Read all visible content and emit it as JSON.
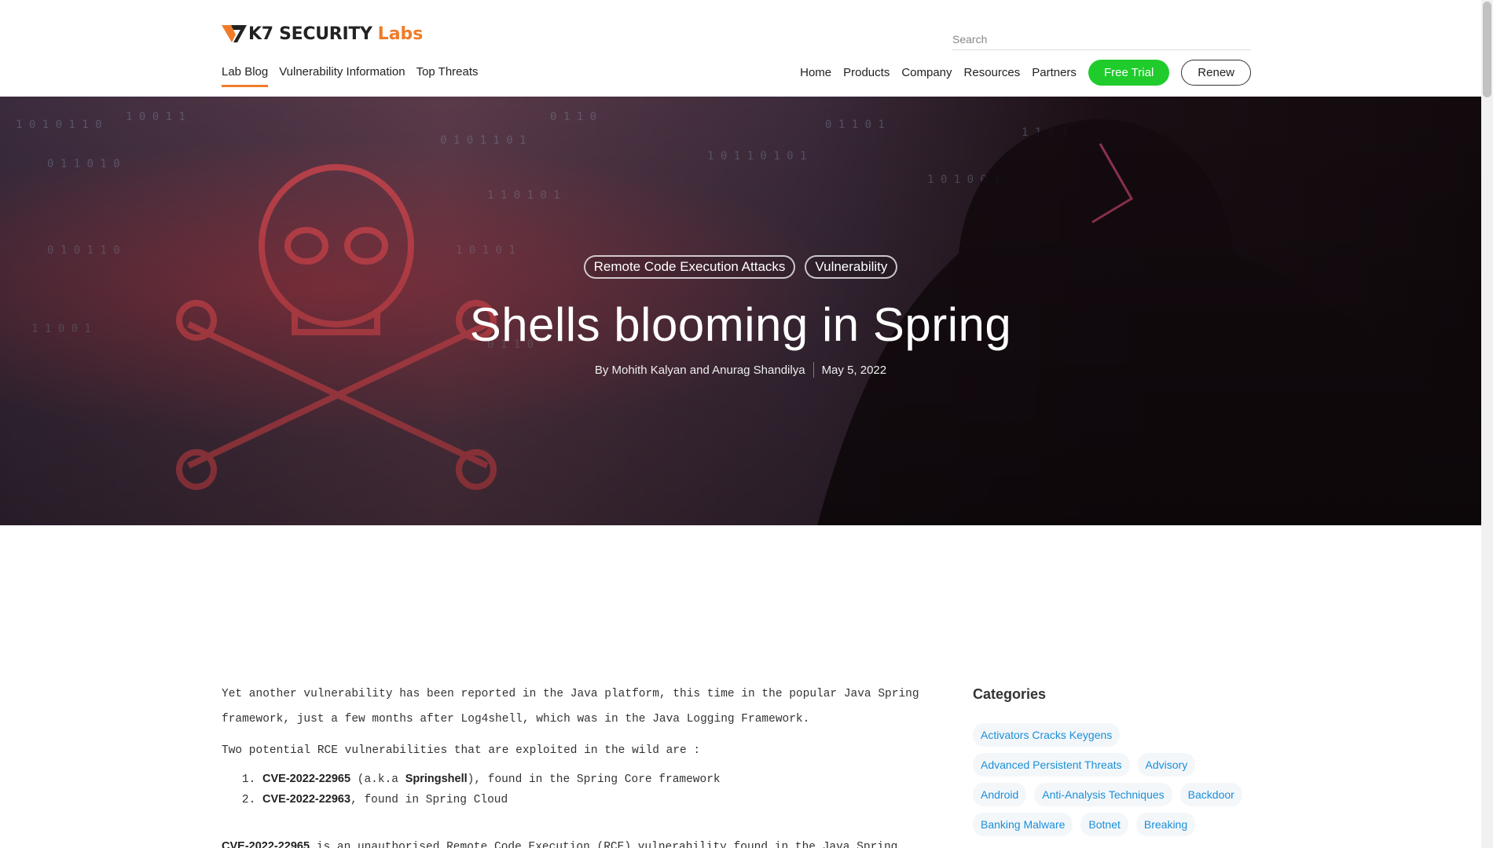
{
  "header": {
    "logo_brand": "K7 SECURITY",
    "logo_labs": "Labs",
    "search_placeholder": "Search",
    "left_nav": [
      "Lab Blog",
      "Vulnerability Information",
      "Top Threats"
    ],
    "right_nav": [
      "Home",
      "Products",
      "Company",
      "Resources",
      "Partners"
    ],
    "free_trial_label": "Free Trial",
    "renew_label": "Renew"
  },
  "hero": {
    "tags": [
      "Remote Code Execution Attacks",
      "Vulnerability"
    ],
    "title": "Shells blooming in Spring",
    "author_line": "By Mohith Kalyan and Anurag Shandilya",
    "date": "May 5, 2022"
  },
  "article": {
    "p1": "Yet another vulnerability has been reported in the Java platform, this time in the popular Java Spring framework, just a few months after Log4shell, which was in the Java Logging Framework.",
    "p2": "Two potential RCE vulnerabilities that are exploited in the wild are :",
    "list": [
      {
        "cve": "CVE-2022-22965",
        "pre": " (a.k.a ",
        "alias": "Springshell",
        "post": "), found in the Spring Core framework"
      },
      {
        "cve": "CVE-2022-22963",
        "pre": ", found in Spring Cloud",
        "alias": "",
        "post": ""
      }
    ],
    "p3_cve": "CVE-2022-22965",
    "p3_rest": " is an unauthorised Remote Code Execution (RCE) vulnerability found in the Java Spring"
  },
  "sidebar": {
    "title": "Categories",
    "categories": [
      "Activators Cracks Keygens",
      "Advanced Persistent Threats",
      "Advisory",
      "Android",
      "Anti-Analysis Techniques",
      "Backdoor",
      "Banking Malware",
      "Botnet",
      "Breaking"
    ]
  },
  "colors": {
    "accent": "#f07c2a",
    "trial": "#1fcc2b",
    "link": "#1a8fd8"
  }
}
